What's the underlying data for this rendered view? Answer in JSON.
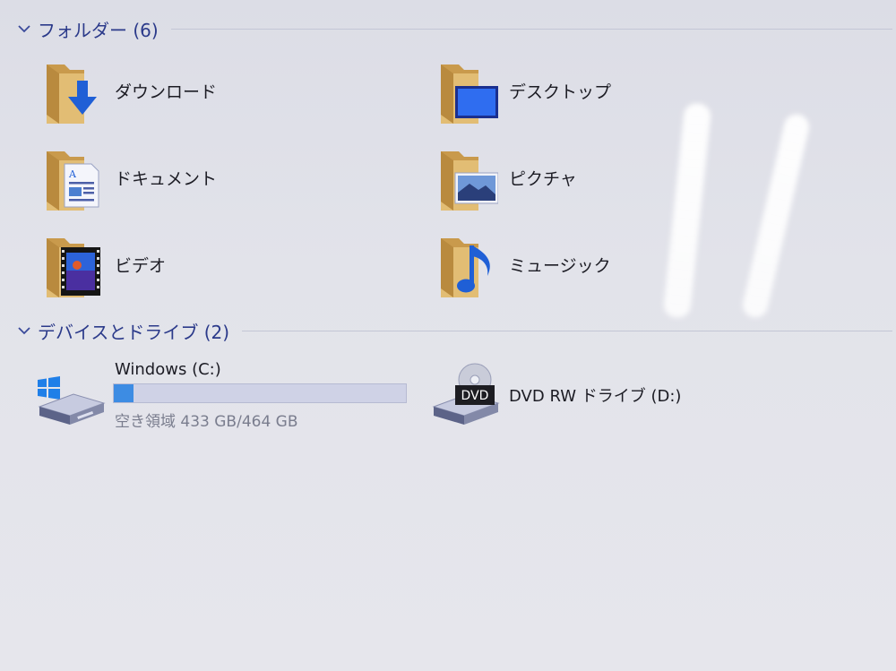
{
  "groups": {
    "folders": {
      "title": "フォルダー (6)"
    },
    "devices": {
      "title": "デバイスとドライブ (2)"
    }
  },
  "folders": [
    {
      "label": "ダウンロード",
      "icon": "downloads-folder-icon"
    },
    {
      "label": "デスクトップ",
      "icon": "desktop-folder-icon"
    },
    {
      "label": "ドキュメント",
      "icon": "documents-folder-icon"
    },
    {
      "label": "ピクチャ",
      "icon": "pictures-folder-icon"
    },
    {
      "label": "ビデオ",
      "icon": "videos-folder-icon"
    },
    {
      "label": "ミュージック",
      "icon": "music-folder-icon"
    }
  ],
  "drives": [
    {
      "name": "Windows (C:)",
      "free_text": "空き領域 433 GB/464 GB",
      "used_fraction": 0.067,
      "icon": "windows-drive-icon"
    },
    {
      "name": "DVD RW ドライブ (D:)",
      "icon": "dvd-drive-icon",
      "badge": "DVD"
    }
  ],
  "colors": {
    "header_text": "#2b3a8a",
    "usage_bar_fill": "#3d8ce3",
    "folder_tan": "#d6ad62",
    "icon_blue": "#1f5fd6"
  }
}
